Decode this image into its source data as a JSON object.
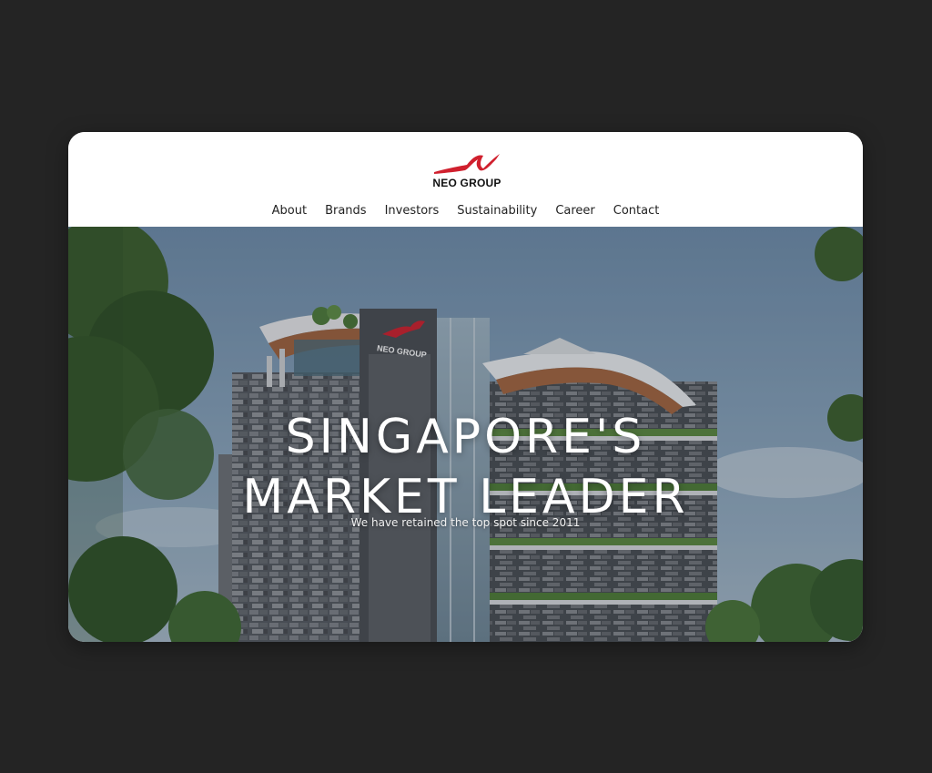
{
  "brand": {
    "name": "NEO GROUP",
    "accent": "#d0202e"
  },
  "nav": {
    "items": [
      {
        "label": "About"
      },
      {
        "label": "Brands"
      },
      {
        "label": "Investors"
      },
      {
        "label": "Sustainability"
      },
      {
        "label": "Career"
      },
      {
        "label": "Contact"
      }
    ]
  },
  "hero": {
    "title_line1": "SINGAPORE'S",
    "title_line2": "MARKET LEADER",
    "subtitle": "We have retained the top spot since 2011",
    "building_sign": "NEO GROUP"
  },
  "colors": {
    "page_bg": "#242424",
    "card_bg": "#ffffff",
    "sky": "#7f9bb5"
  }
}
